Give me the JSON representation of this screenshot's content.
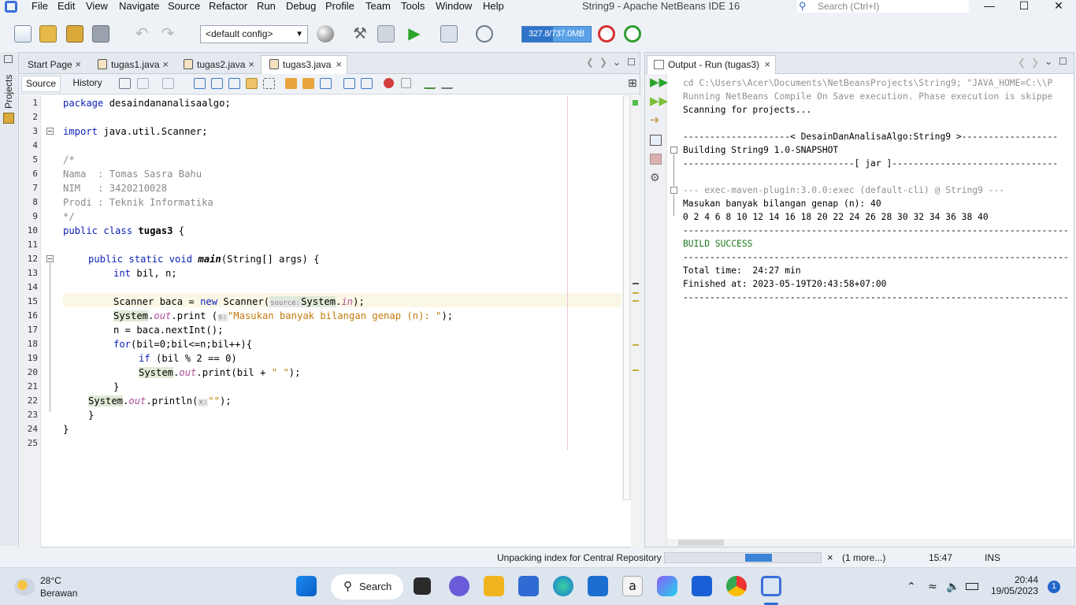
{
  "window": {
    "title": "String9 - Apache NetBeans IDE 16",
    "search_placeholder": "Search (Ctrl+I)",
    "minimize_glyph": "—",
    "maximize_glyph": "☐",
    "close_glyph": "✕"
  },
  "menu": [
    "File",
    "Edit",
    "View",
    "Navigate",
    "Source",
    "Refactor",
    "Run",
    "Debug",
    "Profile",
    "Team",
    "Tools",
    "Window",
    "Help"
  ],
  "toolbar": {
    "config": "<default config>",
    "memory": "327.8/737.0MB",
    "memory_fraction": 0.445
  },
  "left_strip": {
    "label": "Projects"
  },
  "editor": {
    "tabs": [
      {
        "label": "Start Page"
      },
      {
        "label": "tugas1.java"
      },
      {
        "label": "tugas2.java"
      },
      {
        "label": "tugas3.java",
        "active": true
      }
    ],
    "source_label": "Source",
    "history_label": "History",
    "line_numbers": [
      "1",
      "2",
      "3",
      "4",
      "5",
      "6",
      "7",
      "8",
      "9",
      "10",
      "11",
      "12",
      "13",
      "14",
      "15",
      "16",
      "17",
      "18",
      "19",
      "20",
      "21",
      "22",
      "23",
      "24",
      "25"
    ],
    "code": {
      "l1_kw": "package",
      "l1_rest": " desaindananalisaalgo;",
      "l3_kw": "import",
      "l3_rest": " java.util.Scanner;",
      "l5": "/*",
      "l6": "Nama  : Tomas Sasra Bahu",
      "l7": "NIM   : 3420210028",
      "l8": "Prodi : Teknik Informatika",
      "l9": "*/",
      "l10_kw": "public class ",
      "l10_name": "tugas3",
      "l10_rest": " {",
      "l12_kw": "public static void ",
      "l12_name": "main",
      "l12_rest": "(String[] args) {",
      "l13_kw": "int",
      "l13_rest": " bil, n;",
      "l15_a": "Scanner baca = ",
      "l15_kw": "new",
      "l15_b": " Scanner(",
      "l15_hint": "source:",
      "l15_sys": "System",
      "l15_dot": ".",
      "l15_in": "in",
      "l15_end": ");",
      "l16_sys": "System",
      "l16_dot": ".",
      "l16_out": "out",
      "l16_print": ".print (",
      "l16_hint": "s:",
      "l16_str": "\"Masukan banyak bilangan genap (n): \"",
      "l16_end": ");",
      "l17": "n = baca.nextInt();",
      "l18_kw": "for",
      "l18_rest": "(bil=0;bil<=n;bil++){",
      "l19_kw": "if",
      "l19_rest": " (bil % 2 == 0)",
      "l20_sys": "System",
      "l20_dot": ".",
      "l20_out": "out",
      "l20_a": ".print(bil + ",
      "l20_str": "\" \"",
      "l20_end": ");",
      "l21": "}",
      "l22_sys": "System",
      "l22_dot": ".",
      "l22_out": "out",
      "l22_a": ".println(",
      "l22_hint": "x:",
      "l22_str": "\"\"",
      "l22_end": ");",
      "l23": "}",
      "l24": "}"
    }
  },
  "output": {
    "tab_label": "Output - Run (tugas3)",
    "lines": [
      "cd C:\\Users\\Acer\\Documents\\NetBeansProjects\\String9; \"JAVA_HOME=C:\\\\P",
      "Running NetBeans Compile On Save execution. Phase execution is skippe",
      "Scanning for projects...",
      "",
      "--------------------< DesainDanAnalisaAlgo:String9 >------------------",
      "Building String9 1.0-SNAPSHOT",
      "--------------------------------[ jar ]-------------------------------",
      "",
      "--- exec-maven-plugin:3.0.0:exec (default-cli) @ String9 ---",
      "Masukan banyak bilangan genap (n): 40",
      "0 2 4 6 8 10 12 14 16 18 20 22 24 26 28 30 32 34 36 38 40",
      "------------------------------------------------------------------------",
      "BUILD SUCCESS",
      "------------------------------------------------------------------------",
      "Total time:  24:27 min",
      "Finished at: 2023-05-19T20:43:58+07:00",
      "------------------------------------------------------------------------"
    ]
  },
  "status": {
    "task": "Unpacking index for Central Repository",
    "more": "(1 more...)",
    "position": "15:47",
    "mode": "INS",
    "progress_fraction": 0.17
  },
  "taskbar": {
    "temperature": "28°C",
    "weather": "Berawan",
    "search_label": "Search",
    "time": "20:44",
    "date": "19/05/2023",
    "notifications": "1"
  },
  "colors": {
    "keyword": "#0b1fb8",
    "comment": "#8a8a8a",
    "string": "#c27a0c",
    "field": "#b0509a",
    "build_success": "#1e7a1e",
    "accent": "#2f74c9"
  }
}
